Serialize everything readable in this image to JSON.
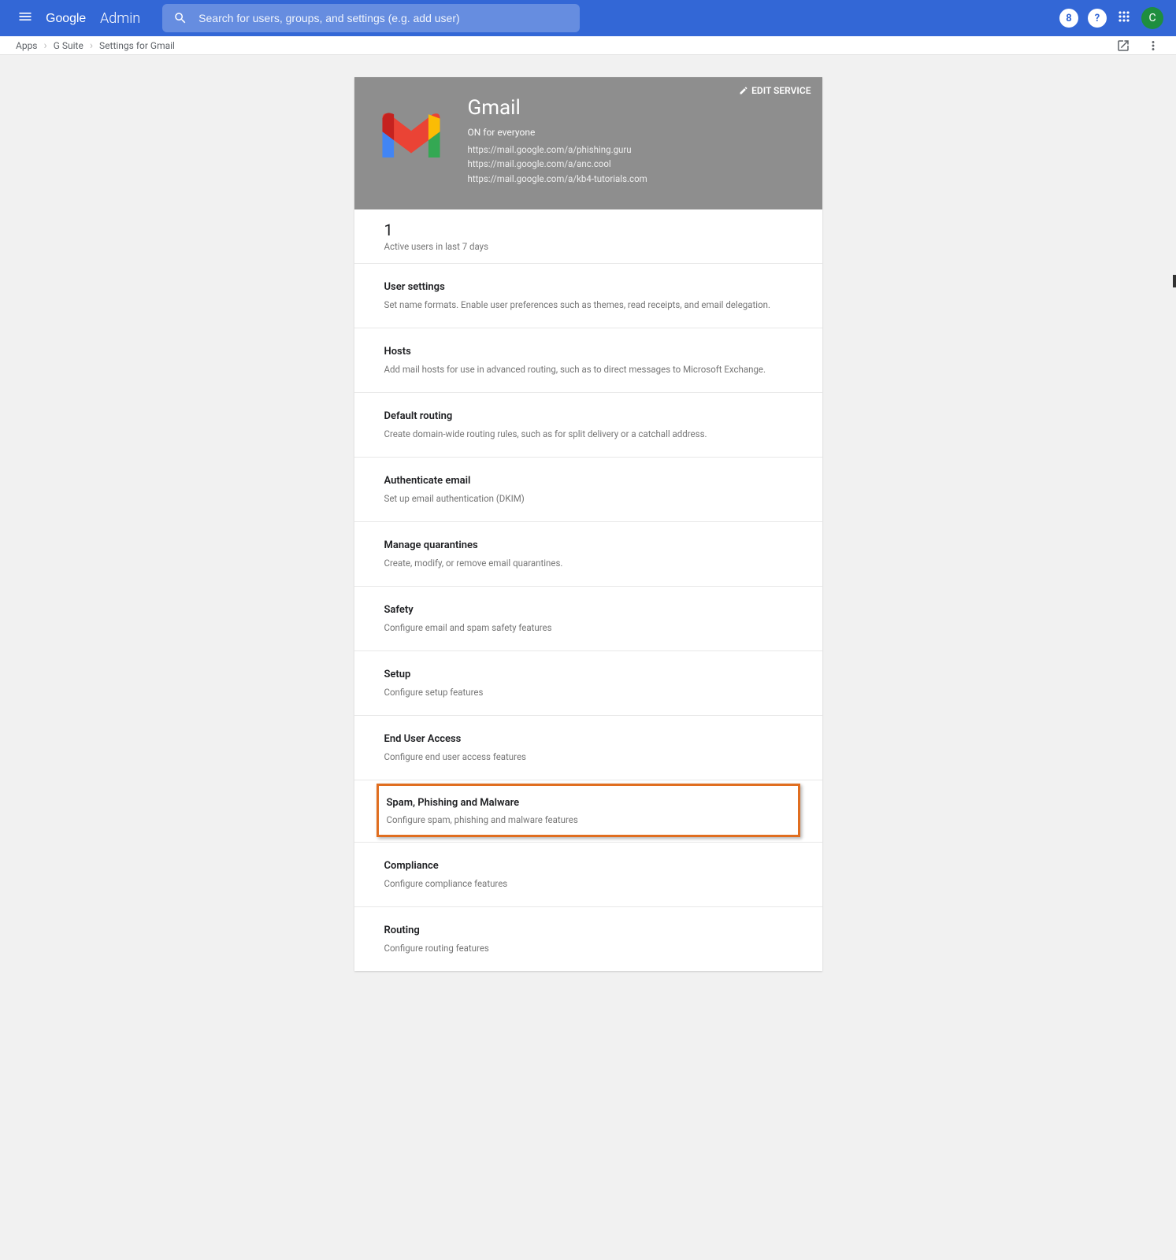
{
  "header": {
    "product": "Google",
    "section": "Admin",
    "search_placeholder": "Search for users, groups, and settings (e.g. add user)",
    "avatar_letter": "C",
    "help_symbol": "?",
    "badge_symbol": "8"
  },
  "breadcrumb": {
    "items": [
      "Apps",
      "G Suite",
      "Settings for Gmail"
    ]
  },
  "service": {
    "name": "Gmail",
    "edit_label": "EDIT SERVICE",
    "status": "ON for everyone",
    "urls": [
      "https://mail.google.com/a/phishing.guru",
      "https://mail.google.com/a/anc.cool",
      "https://mail.google.com/a/kb4-tutorials.com"
    ]
  },
  "stats": {
    "value": "1",
    "label": "Active users in last 7 days"
  },
  "settings": [
    {
      "title": "User settings",
      "desc": "Set name formats. Enable user preferences such as themes, read receipts, and email delegation.",
      "highlighted": false
    },
    {
      "title": "Hosts",
      "desc": "Add mail hosts for use in advanced routing, such as to direct messages to Microsoft Exchange.",
      "highlighted": false
    },
    {
      "title": "Default routing",
      "desc": "Create domain-wide routing rules, such as for split delivery or a catchall address.",
      "highlighted": false
    },
    {
      "title": "Authenticate email",
      "desc": "Set up email authentication (DKIM)",
      "highlighted": false
    },
    {
      "title": "Manage quarantines",
      "desc": "Create, modify, or remove email quarantines.",
      "highlighted": false
    },
    {
      "title": "Safety",
      "desc": "Configure email and spam safety features",
      "highlighted": false
    },
    {
      "title": "Setup",
      "desc": "Configure setup features",
      "highlighted": false
    },
    {
      "title": "End User Access",
      "desc": "Configure end user access features",
      "highlighted": false
    },
    {
      "title": "Spam, Phishing and Malware",
      "desc": "Configure spam, phishing and malware features",
      "highlighted": true
    },
    {
      "title": "Compliance",
      "desc": "Configure compliance features",
      "highlighted": false
    },
    {
      "title": "Routing",
      "desc": "Configure routing features",
      "highlighted": false
    }
  ]
}
